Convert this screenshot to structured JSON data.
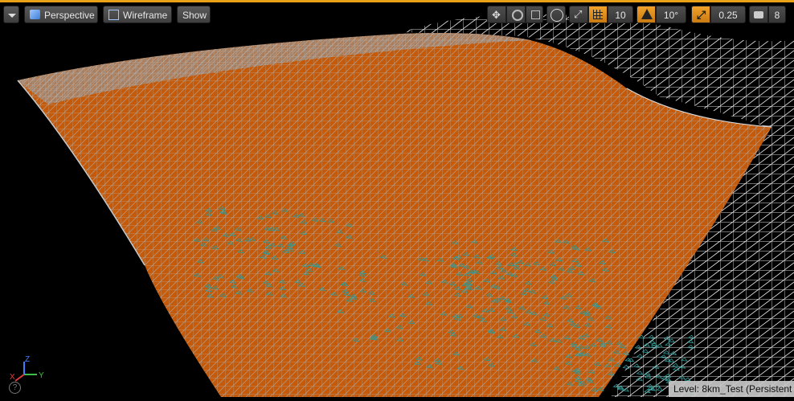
{
  "toolbar": {
    "menu_icon": "chevron-down-icon",
    "perspective_label": "Perspective",
    "wireframe_label": "Wireframe",
    "show_label": "Show",
    "grid_snap_value": "10",
    "rotation_snap_value": "10°",
    "scale_snap_value": "0.25",
    "camera_speed_value": "8"
  },
  "status": {
    "level_text": "Level:  8km_Test (Persistent"
  },
  "axes": {
    "x": "X",
    "y": "Y",
    "z": "Z"
  },
  "colors": {
    "accent": "#e8a21a",
    "terrain_fill": "#c45a0a",
    "wire_light": "#b9b9b9",
    "wire_teal": "#2f9a96"
  }
}
